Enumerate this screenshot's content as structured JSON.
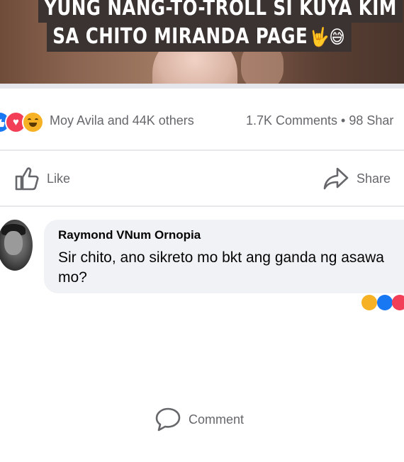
{
  "post_media": {
    "caption_line1": "YUNG NANG-TO-TROLL SI KUYA KIM",
    "caption_line2": "SA CHITO MIRANDA PAGE",
    "caption_emoji": "🤟😅"
  },
  "reactions": {
    "types": [
      "like-icon",
      "love-icon",
      "haha-icon"
    ],
    "reactors_text": "Moy Avila and 44K others",
    "counts_text": "1.7K Comments • 98 Shar"
  },
  "actions": {
    "like_label": "Like",
    "comment_label": "Comment",
    "share_label": "Share"
  },
  "comment": {
    "author": "Raymond VNum Ornopia",
    "text": "Sir chito, ano sikreto mo bkt ang ganda ng asawa mo?"
  },
  "colors": {
    "like_blue": "#1877f2",
    "love_red": "#f33e58",
    "haha_yellow": "#f7b125",
    "secondary_text": "#65676b",
    "bubble_bg": "#f0f2f5"
  }
}
